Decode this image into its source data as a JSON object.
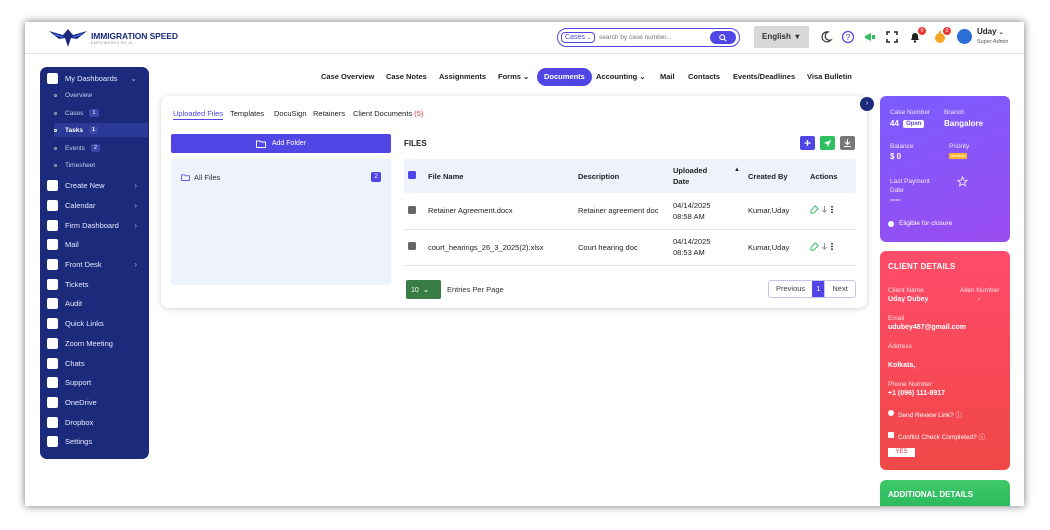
{
  "brand": {
    "name": "IMMIGRATION SPEED",
    "tagline": "EMPOWERED BY AI"
  },
  "search": {
    "type": "Cases",
    "placeholder": "search by case number..."
  },
  "language": "English",
  "notifications": {
    "bell_count": "0",
    "timer_count": "0"
  },
  "user": {
    "name": "Uday",
    "role": "Super Admin"
  },
  "sidebar": {
    "top": "My Dashboards",
    "subs": [
      {
        "label": "Overview",
        "count": ""
      },
      {
        "label": "Cases",
        "count": "1"
      },
      {
        "label": "Tasks",
        "count": "1"
      },
      {
        "label": "Events",
        "count": "2"
      },
      {
        "label": "Timesheet",
        "count": ""
      }
    ],
    "items": [
      "Create New",
      "Calendar",
      "Firm Dashboard",
      "Mail",
      "Front Desk",
      "Tickets",
      "Audit",
      "Quick Links",
      "Zoom Meeting",
      "Chats",
      "Support",
      "OneDrive",
      "Dropbox",
      "Settings"
    ]
  },
  "tabs": [
    "Case Overview",
    "Case Notes",
    "Assignments",
    "Forms",
    "Documents",
    "Accounting",
    "Mail",
    "Contacts",
    "Events/Deadlines",
    "Visa Bulletin"
  ],
  "subtabs": {
    "uploaded": "Uploaded Files",
    "templates": "Templates",
    "docusign": "DocuSign",
    "retainers": "Retainers",
    "client_docs": "Client Documents",
    "client_docs_count": "(5)"
  },
  "add_folder": "Add Folder",
  "folders": {
    "all_files": "All Files",
    "count": "2"
  },
  "files": {
    "title": "FILES",
    "headers": {
      "name": "File Name",
      "desc": "Description",
      "date": "Uploaded Date",
      "by": "Created By",
      "actions": "Actions"
    },
    "rows": [
      {
        "name": "Retainer Agreement.docx",
        "desc": "Retainer agreement doc",
        "date": "04/14/2025",
        "time": "08:58 AM",
        "by": "Kumar,Uday"
      },
      {
        "name": "court_hearings_26_3_2025(2).xlsx",
        "desc": "Court hearing doc",
        "date": "04/14/2025",
        "time": "08:53 AM",
        "by": "Kumar,Uday"
      }
    ]
  },
  "pagination": {
    "per_page": "10",
    "per_page_label": "Entries Per Page",
    "prev": "Previous",
    "current": "1",
    "next": "Next"
  },
  "case_info": {
    "case_number_label": "Case Number",
    "case_number": "44",
    "status": "Open",
    "branch_label": "Branch",
    "branch": "Bangalore",
    "balance_label": "Balance",
    "balance": "$ 0",
    "priority_label": "Priority",
    "priority": "medium",
    "last_payment_label": "Last Payment Date",
    "last_payment": "----",
    "closure": "Eligible for closure"
  },
  "client": {
    "heading": "CLIENT DETAILS",
    "name_label": "Client Name",
    "name": "Uday Dubey",
    "alien_label": "Alien Number",
    "alien": "-",
    "email_label": "Email",
    "email": "udubey487@gmail.com",
    "address_label": "Address",
    "address": "Kolkata,",
    "phone_label": "Phone Number",
    "phone": "+1 (096) 111-8917",
    "review": "Send Review Link?",
    "conflict": "Conflict Check Completed?",
    "conflict_answer": "YES"
  },
  "additional": {
    "heading": "ADDITIONAL DETAILS"
  },
  "colors": {
    "primary": "#4f46e5",
    "sidebar": "#1b2a7a",
    "purple": "#8a55f5",
    "red": "#f5475f",
    "green": "#2fbf60"
  }
}
